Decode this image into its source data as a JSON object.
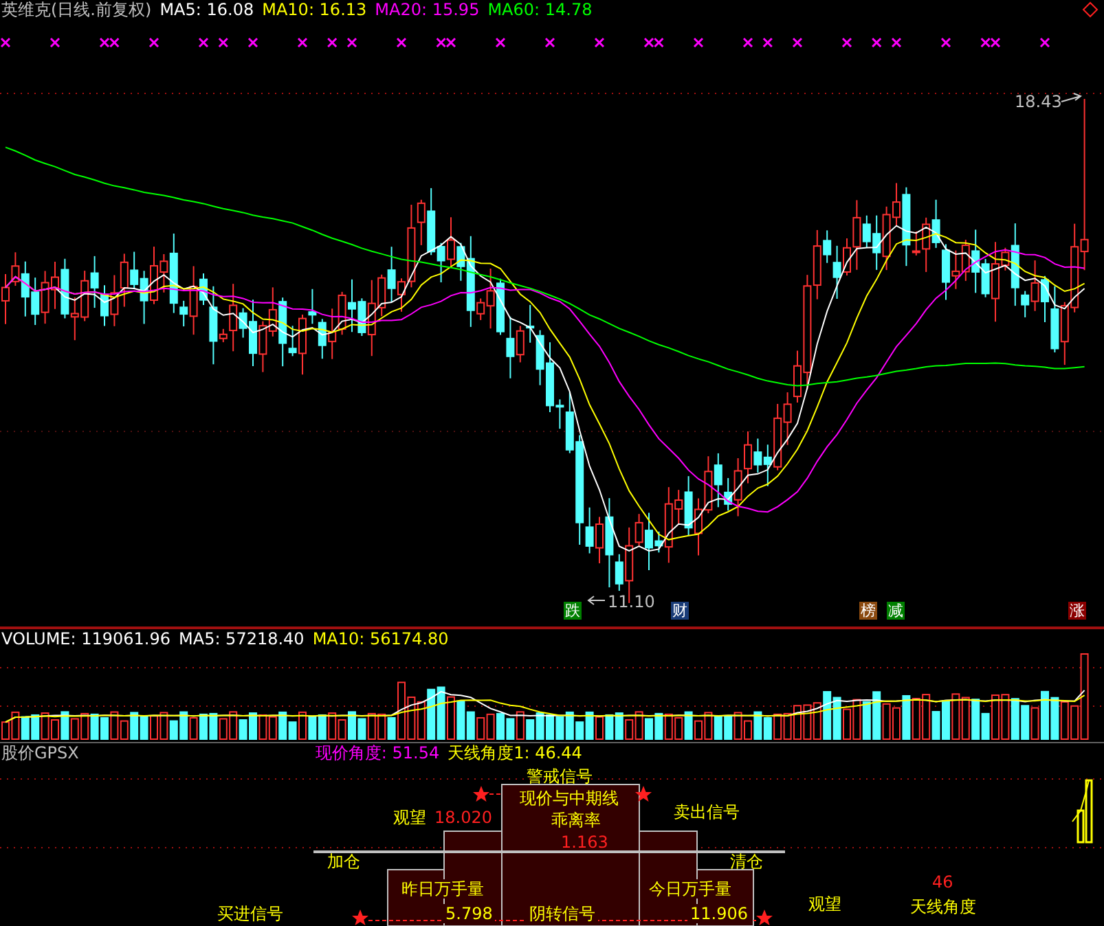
{
  "title": "英维克(日线.前复权)",
  "ma_legend": [
    {
      "label": "MA5: 16.08",
      "color": "#ffffff"
    },
    {
      "label": "MA10: 16.13",
      "color": "#ffff00"
    },
    {
      "label": "MA20: 15.95",
      "color": "#ff00ff"
    },
    {
      "label": "MA60: 14.78",
      "color": "#00ff00"
    }
  ],
  "price_chart": {
    "high_label": "18.43",
    "low_label": "11.10",
    "event_tags": [
      {
        "label": "跌",
        "color": "#008000"
      },
      {
        "label": "财",
        "color": "#1a3c78"
      },
      {
        "label": "榜",
        "color": "#8b4a10"
      },
      {
        "label": "减",
        "color": "#008000"
      },
      {
        "label": "涨",
        "color": "#8b0000"
      }
    ]
  },
  "volume": {
    "legend": [
      {
        "label": "VOLUME: 119061.96",
        "color": "#ffffff"
      },
      {
        "label": "MA5: 57218.40",
        "color": "#ffffff"
      },
      {
        "label": "MA10: 56174.80",
        "color": "#ffff00"
      }
    ]
  },
  "indicator": {
    "name": "股价GPSX",
    "legend": [
      {
        "label": "现价角度: 51.54",
        "color": "#ff00ff"
      },
      {
        "label": "天线角度1: 46.44",
        "color": "#ffff00"
      }
    ],
    "labels": [
      {
        "text": "警戒信号",
        "kind": "label"
      },
      {
        "text": "现价与中期线",
        "kind": "label"
      },
      {
        "text": "观望",
        "kind": "label"
      },
      {
        "text": "18.020",
        "kind": "value"
      },
      {
        "text": "乖离率",
        "kind": "label"
      },
      {
        "text": "卖出信号",
        "kind": "label"
      },
      {
        "text": "1.163",
        "kind": "value"
      },
      {
        "text": "加仓",
        "kind": "label"
      },
      {
        "text": "清仓",
        "kind": "label"
      },
      {
        "text": "昨日万手量",
        "kind": "label"
      },
      {
        "text": "今日万手量",
        "kind": "label"
      },
      {
        "text": "46",
        "kind": "value"
      },
      {
        "text": "观望",
        "kind": "label"
      },
      {
        "text": "天线角度",
        "kind": "label"
      },
      {
        "text": "买进信号",
        "kind": "label"
      },
      {
        "text": "5.798",
        "kind": "label"
      },
      {
        "text": "阴转信号",
        "kind": "label"
      },
      {
        "text": "11.906",
        "kind": "label"
      }
    ]
  }
}
